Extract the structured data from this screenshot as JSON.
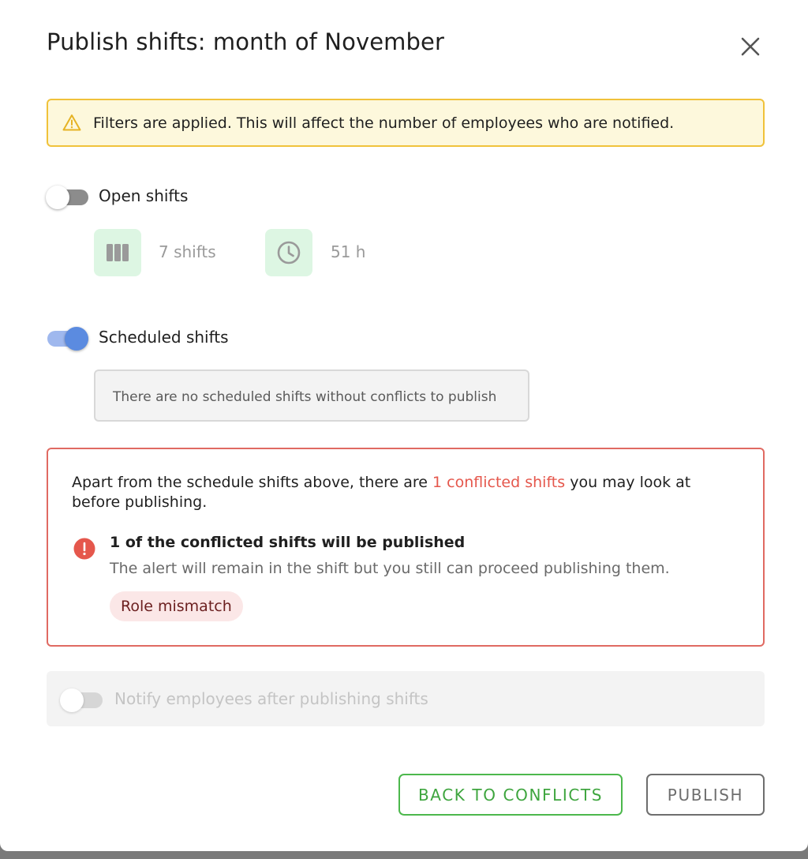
{
  "dialog": {
    "title": "Publish shifts: month of November"
  },
  "warning": {
    "text": "Filters are applied. This will affect the number of employees who are notified.",
    "border_color": "#f0c23a",
    "background_color": "#fdf8dc"
  },
  "open_shifts": {
    "label": "Open shifts",
    "enabled": false,
    "shift_count": "7 shifts",
    "hours": "51 h"
  },
  "scheduled_shifts": {
    "label": "Scheduled shifts",
    "enabled": true,
    "empty_message": "There are no scheduled shifts without conflicts to publish"
  },
  "conflicts": {
    "intro_before": "Apart from the schedule shifts above, there are ",
    "link_text": "1 conflicted shifts",
    "intro_after": " you may look at before publishing.",
    "heading": "1 of the conflicted shifts will be published",
    "description": "The alert will remain in the shift but you still can proceed publishing them.",
    "chip": "Role mismatch",
    "accent_color": "#e5574c"
  },
  "notify": {
    "label": "Notify employees after publishing shifts",
    "enabled": false,
    "disabled": true
  },
  "actions": {
    "back_label": "BACK TO CONFLICTS",
    "publish_label": "PUBLISH",
    "back_color": "#3ea53e"
  }
}
